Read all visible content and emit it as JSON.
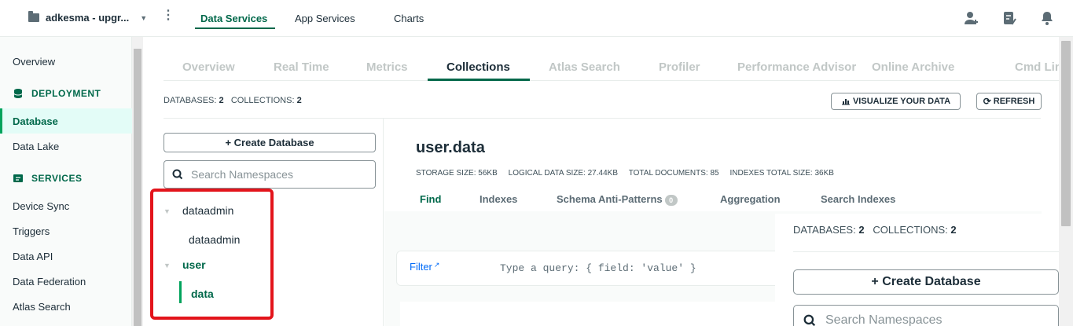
{
  "topbar": {
    "project_name": "adkesma - upgr...",
    "tabs": [
      "Data Services",
      "App Services",
      "Charts"
    ],
    "icons": [
      "invite-user-icon",
      "activity-feed-icon",
      "notifications-icon"
    ]
  },
  "sidebar": {
    "overview": "Overview",
    "deployment_header": "DEPLOYMENT",
    "deployment_items": [
      "Database",
      "Data Lake"
    ],
    "services_header": "SERVICES",
    "services_items": [
      "Device Sync",
      "Triggers",
      "Data API",
      "Data Federation",
      "Atlas Search"
    ]
  },
  "cluster_tabs": [
    "Overview",
    "Real Time",
    "Metrics",
    "Collections",
    "Atlas Search",
    "Profiler",
    "Performance Advisor",
    "Online Archive",
    "Cmd Lin"
  ],
  "summary": {
    "databases_label": "DATABASES:",
    "databases_value": "2",
    "collections_label": "COLLECTIONS:",
    "collections_value": "2",
    "visualize_label": "VISUALIZE YOUR DATA",
    "refresh_label": "REFRESH"
  },
  "namespace_panel": {
    "create_db_label": "+ Create Database",
    "search_placeholder": "Search Namespaces",
    "tree": [
      {
        "db": "dataadmin",
        "collections": [
          "dataadmin"
        ]
      },
      {
        "db": "user",
        "collections": [
          "data"
        ]
      }
    ]
  },
  "collection": {
    "title": "user.data",
    "storage_size_label": "STORAGE SIZE:",
    "storage_size": "56KB",
    "logical_size_label": "LOGICAL DATA SIZE:",
    "logical_size": "27.44KB",
    "total_docs_label": "TOTAL DOCUMENTS:",
    "total_docs": "85",
    "indexes_size_label": "INDEXES TOTAL SIZE:",
    "indexes_size": "36KB",
    "tabs": [
      "Find",
      "Indexes",
      "Schema Anti-Patterns",
      "Aggregation",
      "Search Indexes"
    ],
    "schema_badge": "0",
    "filter_label": "Filter",
    "filter_placeholder": "Type a query: { field: 'value' }"
  },
  "overlay": {
    "databases_label": "DATABASES:",
    "databases_value": "2",
    "collections_label": "COLLECTIONS:",
    "collections_value": "2",
    "create_db_label": "+ Create Database",
    "search_placeholder": "Search Namespaces"
  },
  "colors": {
    "brand_green": "#00684a",
    "accent_green": "#00a35c",
    "highlight_red": "#e3141b",
    "link_blue": "#016bf8"
  }
}
